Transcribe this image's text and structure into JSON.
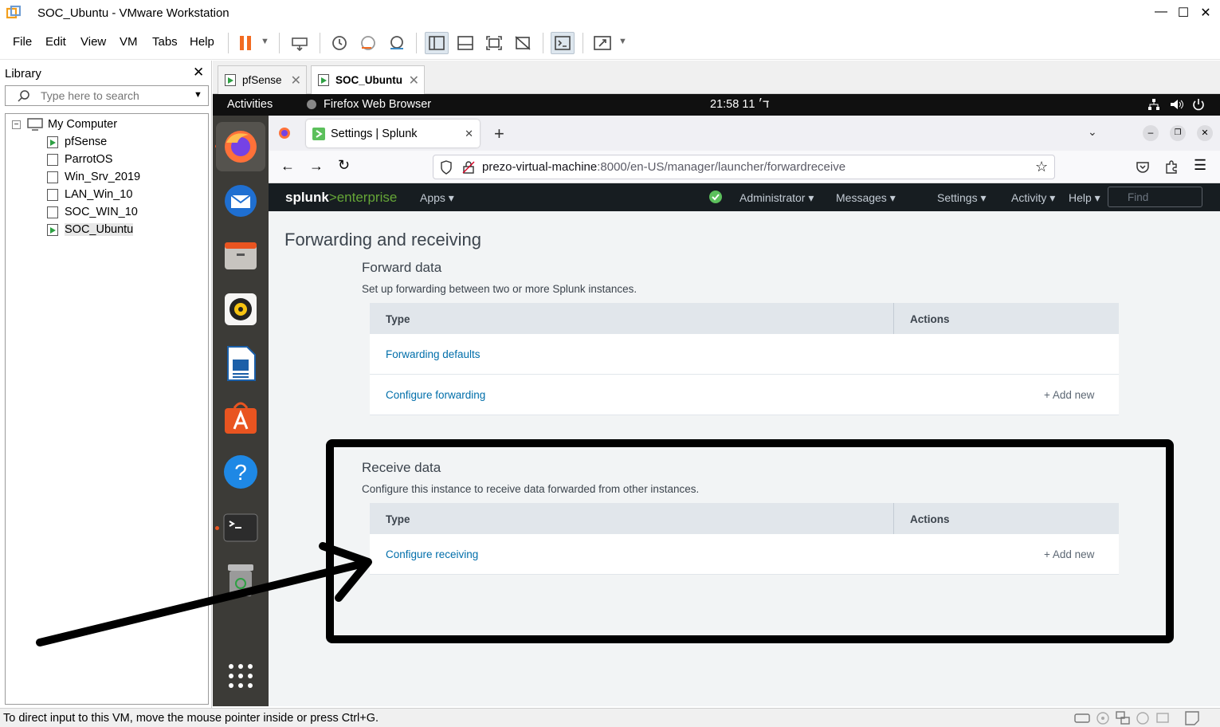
{
  "window": {
    "title": "SOC_Ubuntu - VMware Workstation"
  },
  "menu": [
    "File",
    "Edit",
    "View",
    "VM",
    "Tabs",
    "Help"
  ],
  "library": {
    "title": "Library",
    "search_placeholder": "Type here to search",
    "root": "My Computer",
    "vms": [
      {
        "name": "pfSense",
        "running": true
      },
      {
        "name": "ParrotOS",
        "running": false
      },
      {
        "name": "Win_Srv_2019",
        "running": false
      },
      {
        "name": "LAN_Win_10",
        "running": false
      },
      {
        "name": "SOC_WIN_10",
        "running": false
      },
      {
        "name": "SOC_Ubuntu",
        "running": true,
        "selected": true
      }
    ]
  },
  "vm_tabs": [
    {
      "label": "pfSense",
      "active": false
    },
    {
      "label": "SOC_Ubuntu",
      "active": true
    }
  ],
  "gnome": {
    "activities": "Activities",
    "app": "Firefox Web Browser",
    "clock": "ד׳ 11  21:58"
  },
  "firefox": {
    "tab_title": "Settings | Splunk",
    "url_host": "prezo-virtual-machine",
    "url_rest": ":8000/en-US/manager/launcher/forwardreceive"
  },
  "splunk": {
    "logo_a": "splunk",
    "logo_b": ">enterprise",
    "apps": "Apps",
    "menus": [
      "Administrator",
      "Messages",
      "Settings",
      "Activity",
      "Help"
    ],
    "find_placeholder": "Find",
    "page_title": "Forwarding and receiving",
    "forward": {
      "title": "Forward data",
      "desc": "Set up forwarding between two or more Splunk instances.",
      "col_type": "Type",
      "col_actions": "Actions",
      "rows": [
        {
          "label": "Forwarding defaults",
          "action": ""
        },
        {
          "label": "Configure forwarding",
          "action": "+ Add new"
        }
      ]
    },
    "receive": {
      "title": "Receive data",
      "desc": "Configure this instance to receive data forwarded from other instances.",
      "col_type": "Type",
      "col_actions": "Actions",
      "rows": [
        {
          "label": "Configure receiving",
          "action": "+ Add new"
        }
      ]
    }
  },
  "status": {
    "text": "To direct input to this VM, move the mouse pointer inside or press Ctrl+G."
  },
  "colors": {
    "highlight": "#000000",
    "splunk_green": "#5cc05c",
    "ubuntu_orange": "#e95420"
  }
}
